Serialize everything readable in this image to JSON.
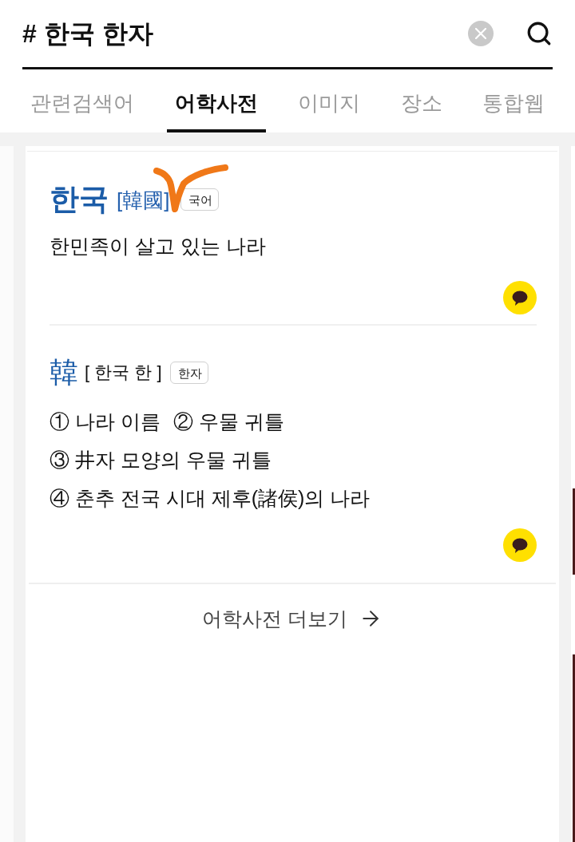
{
  "search": {
    "query": "# 한국 한자"
  },
  "tabs": [
    {
      "label": "관련검색어",
      "selected": false
    },
    {
      "label": "어학사전",
      "selected": true
    },
    {
      "label": "이미지",
      "selected": false
    },
    {
      "label": "장소",
      "selected": false
    },
    {
      "label": "통합웹",
      "selected": false
    }
  ],
  "entries": [
    {
      "kind": "word",
      "headword": "한국",
      "hanja": "[韓國]",
      "tag": "국어",
      "definition_lines": [
        [
          "한민족이 살고 있는 나라"
        ]
      ]
    },
    {
      "kind": "hanja",
      "headword": "韓",
      "reading": "[ 한국 한 ]",
      "tag": "한자",
      "definition_lines": [
        [
          "① 나라 이름",
          "② 우물 귀틀"
        ],
        [
          "③ 井자 모양의 우물 귀틀"
        ],
        [
          "④ 춘추 전국 시대 제후(諸侯)의 나라"
        ]
      ]
    }
  ],
  "more_link": {
    "label": "어학사전 더보기"
  }
}
